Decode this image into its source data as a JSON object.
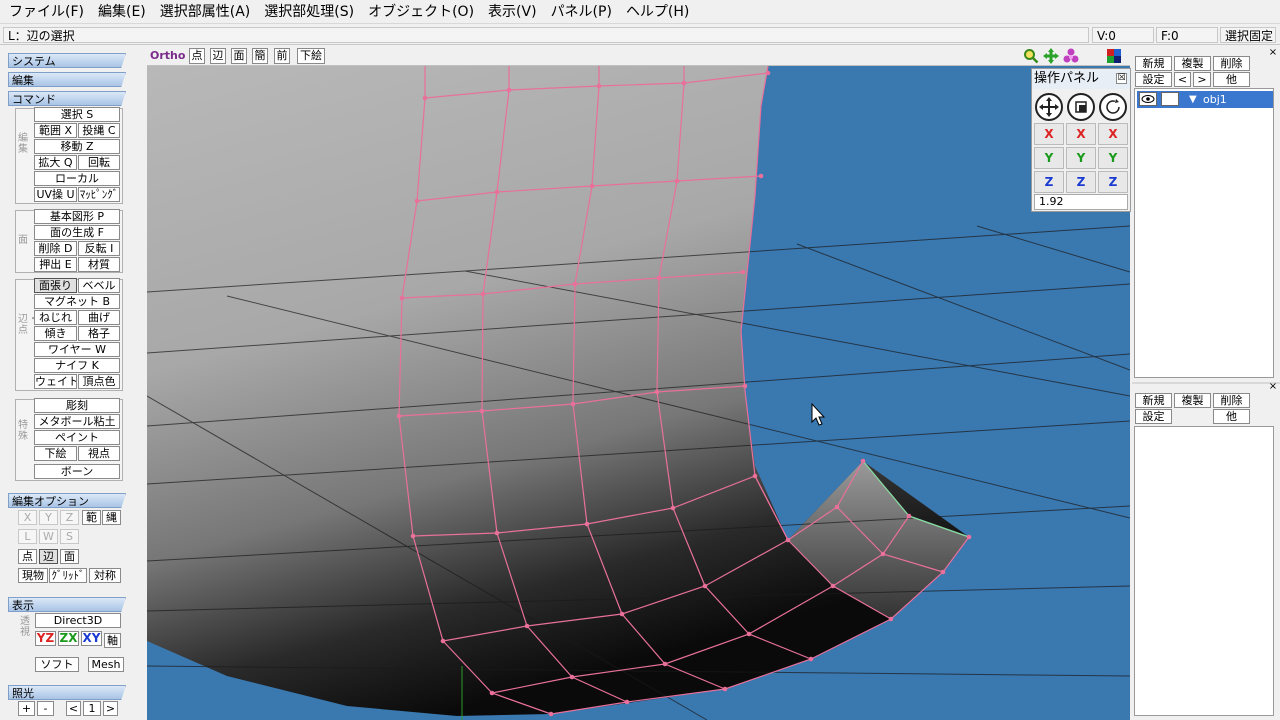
{
  "menu": [
    "ファイル(F)",
    "編集(E)",
    "選択部属性(A)",
    "選択部処理(S)",
    "オブジェクト(O)",
    "表示(V)",
    "パネル(P)",
    "ヘルプ(H)"
  ],
  "status": {
    "hint": "L：辺の選択",
    "v_count": "V:0",
    "f_count": "F:0",
    "lock": "選択固定"
  },
  "left": {
    "sections": {
      "system": "システム",
      "edit": "編集",
      "command": "コマンド",
      "edit_option": "編集オプション",
      "display": "表示",
      "light": "照光"
    },
    "groups": {
      "edit": "編集",
      "face": "面",
      "edge_vertex": "辺・点",
      "special": "特殊",
      "view": "透視"
    },
    "edit_buttons": {
      "select": "選択 S",
      "range": "範囲 X",
      "lasso": "投縄 C",
      "move": "移動 Z",
      "scale": "拡大 Q",
      "rotate": "回転",
      "local": "ローカル",
      "uv": "UV操 U",
      "mapping": "ﾏｯﾋﾟﾝｸﾞ"
    },
    "face_buttons": {
      "primitive": "基本図形 P",
      "create_face": "面の生成 F",
      "delete": "削除 D",
      "flip": "反転 I",
      "extrude": "押出 E",
      "material": "材質"
    },
    "edge_buttons": {
      "face_stretch": "面張り",
      "bevel": "ベベル",
      "magnet": "マグネット B",
      "twist": "ねじれ",
      "bend": "曲げ",
      "tilt": "傾き",
      "lattice": "格子",
      "wire": "ワイヤー W",
      "knife": "ナイフ K",
      "weight": "ウェイト",
      "vertex_color": "頂点色"
    },
    "special_buttons": {
      "sculpt": "彫刻",
      "metaball": "メタボール粘土",
      "paint": "ペイント",
      "underlay": "下絵",
      "viewpoint": "視点",
      "bone": "ボーン"
    },
    "options": {
      "x": "X",
      "y": "Y",
      "z": "Z",
      "range": "範",
      "lasso": "縄",
      "l": "L",
      "w": "W",
      "s": "S",
      "point": "点",
      "edge": "辺",
      "face": "面",
      "object": "現物",
      "grid": "ｸﾞﾘｯﾄﾞ",
      "symmetry": "対称"
    },
    "display": {
      "renderer": "Direct3D",
      "yz": "YZ",
      "zx": "ZX",
      "xy": "XY",
      "axis": "軸",
      "soft": "ソフト",
      "mesh": "Mesh"
    },
    "light": {
      "plus": "+",
      "minus": "-",
      "prev": "<",
      "value": "1",
      "next": ">"
    }
  },
  "viewport": {
    "mode": "Ortho",
    "buttons": [
      "点",
      "辺",
      "面",
      "簡",
      "前",
      "下絵"
    ]
  },
  "op_panel": {
    "title": "操作パネル",
    "close": "☒",
    "value": "1.92",
    "axes": [
      "X",
      "Y",
      "Z"
    ]
  },
  "right": {
    "object_buttons": {
      "new": "新規",
      "duplicate": "複製",
      "delete": "削除",
      "settings": "設定",
      "prev": "<",
      "next": ">",
      "other": "他"
    },
    "object_item": "obj1",
    "material_buttons": {
      "new": "新規",
      "duplicate": "複製",
      "delete": "削除",
      "settings": "設定",
      "other": "他"
    }
  },
  "colors": {
    "viewport_bg": "#3a78b0",
    "wire": "#e8709a",
    "panel": "#f0f0f0",
    "section": "#a9c4e6"
  }
}
